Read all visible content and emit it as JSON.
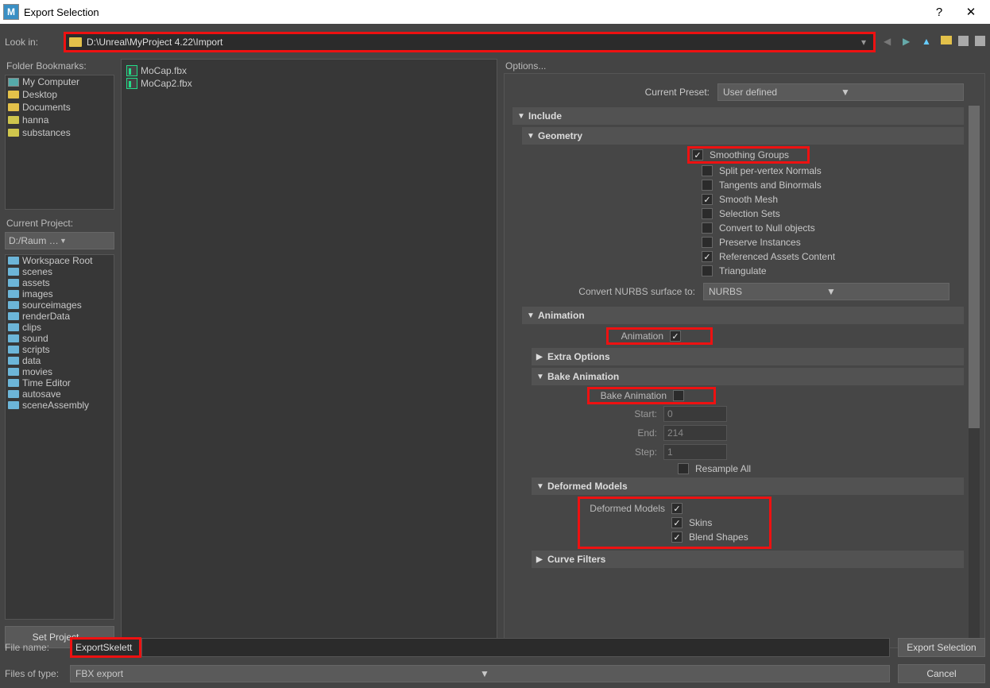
{
  "window": {
    "title": "Export Selection"
  },
  "lookin": {
    "label": "Look in:",
    "path": "D:\\Unreal\\MyProject 4.22\\Import"
  },
  "bookmarks": {
    "header": "Folder Bookmarks:",
    "items": [
      "My Computer",
      "Desktop",
      "Documents",
      "hanna",
      "substances"
    ]
  },
  "project": {
    "header": "Current Project:",
    "value": "D:/Raum & Orientie",
    "workspace": [
      "Workspace Root",
      "scenes",
      "assets",
      "images",
      "sourceimages",
      "renderData",
      "clips",
      "sound",
      "scripts",
      "data",
      "movies",
      "Time Editor",
      "autosave",
      "sceneAssembly"
    ],
    "set_button": "Set Project..."
  },
  "files": [
    "MoCap.fbx",
    "MoCap2.fbx"
  ],
  "options": {
    "header": "Options...",
    "preset_label": "Current Preset:",
    "preset_value": "User defined",
    "include": "Include",
    "geometry": {
      "title": "Geometry",
      "smoothing_groups": "Smoothing Groups",
      "split_normals": "Split per-vertex Normals",
      "tangents": "Tangents and Binormals",
      "smooth_mesh": "Smooth Mesh",
      "selection_sets": "Selection Sets",
      "null_objects": "Convert to Null objects",
      "preserve_instances": "Preserve Instances",
      "ref_assets": "Referenced Assets Content",
      "triangulate": "Triangulate",
      "nurbs_label": "Convert NURBS surface to:",
      "nurbs_value": "NURBS"
    },
    "animation": {
      "title": "Animation",
      "anim_label": "Animation",
      "extra": "Extra Options",
      "bake_title": "Bake Animation",
      "bake_label": "Bake Animation",
      "start_label": "Start:",
      "start_val": "0",
      "end_label": "End:",
      "end_val": "214",
      "step_label": "Step:",
      "step_val": "1",
      "resample": "Resample All"
    },
    "deformed": {
      "title": "Deformed Models",
      "dm_label": "Deformed Models",
      "skins": "Skins",
      "blend": "Blend Shapes"
    },
    "curve_filters": "Curve Filters"
  },
  "footer": {
    "filename_label": "File name:",
    "filename_value": "ExportSkelett",
    "export_btn": "Export Selection",
    "type_label": "Files of type:",
    "type_value": "FBX export",
    "cancel_btn": "Cancel"
  }
}
